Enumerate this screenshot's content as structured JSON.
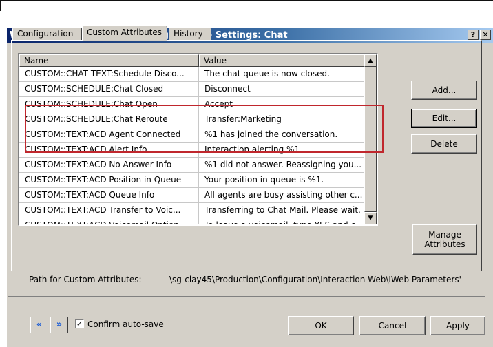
{
  "window": {
    "title": "Web Services Parameter Configuration - Settings: Chat",
    "help_label": "?",
    "close_label": "✕"
  },
  "tabs": [
    {
      "label": "Configuration",
      "active": false
    },
    {
      "label": "Custom Attributes",
      "active": true
    },
    {
      "label": "History",
      "active": false
    }
  ],
  "table": {
    "columns": [
      "Name",
      "Value"
    ],
    "rows": [
      {
        "name": "CUSTOM::CHAT TEXT:Schedule Disco...",
        "value": "The chat queue is now closed."
      },
      {
        "name": "CUSTOM::SCHEDULE:Chat Closed",
        "value": "Disconnect"
      },
      {
        "name": "CUSTOM::SCHEDULE:Chat Open",
        "value": "Accept"
      },
      {
        "name": "CUSTOM::SCHEDULE:Chat Reroute",
        "value": "Transfer:Marketing"
      },
      {
        "name": "CUSTOM::TEXT:ACD Agent Connected",
        "value": "%1 has joined the conversation."
      },
      {
        "name": "CUSTOM::TEXT:ACD Alert Info",
        "value": "Interaction alerting %1."
      },
      {
        "name": "CUSTOM::TEXT:ACD No Answer Info",
        "value": "%1 did not answer. Reassigning you..."
      },
      {
        "name": "CUSTOM::TEXT:ACD Position in Queue",
        "value": "Your position in queue is %1."
      },
      {
        "name": "CUSTOM::TEXT:ACD Queue Info",
        "value": "All agents are busy assisting other c..."
      },
      {
        "name": "CUSTOM::TEXT:ACD Transfer to Voic...",
        "value": "Transferring to Chat Mail.  Please wait."
      },
      {
        "name": "CUSTOM::TEXT:ACD Voicemail Option",
        "value": "To leave a voicemail, type YES and c..."
      }
    ]
  },
  "buttons": {
    "add": "Add...",
    "edit": "Edit...",
    "delete": "Delete",
    "manage_line1": "Manage",
    "manage_line2": "Attributes",
    "ok": "OK",
    "cancel": "Cancel",
    "apply": "Apply"
  },
  "path": {
    "label": "Path for Custom Attributes:",
    "value": "\\sg-clay45\\Production\\Configuration\\Interaction Web\\IWeb Parameters'"
  },
  "footer": {
    "back_icon": "«",
    "forward_icon": "»",
    "confirm_label": "Confirm auto-save",
    "confirm_checked": true
  },
  "colors": {
    "highlight": "#c0272d",
    "nav_icon": "#1f5fd6"
  }
}
